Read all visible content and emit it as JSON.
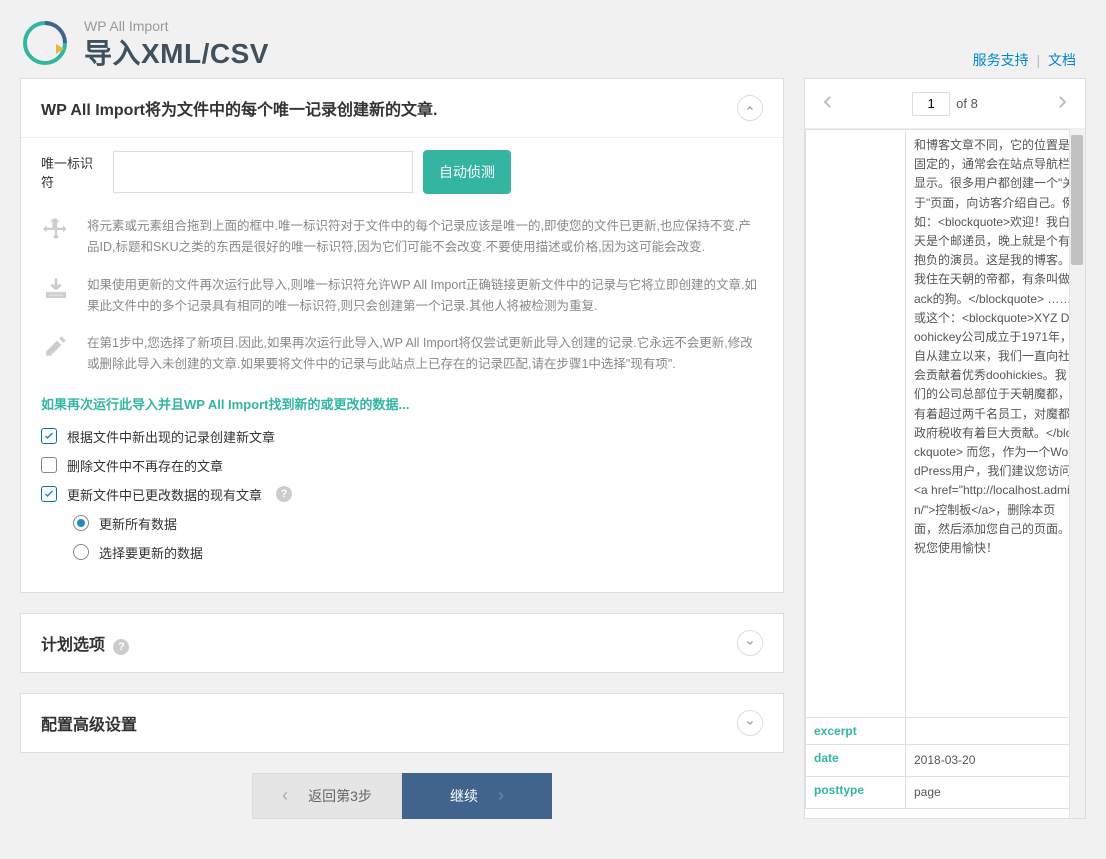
{
  "header": {
    "subtitle": "WP All Import",
    "title": "导入XML/CSV",
    "support_link": "服务支持",
    "docs_link": "文档"
  },
  "panel_records": {
    "title": "WP All Import将为文件中的每个唯一记录创建新的文章.",
    "unique_label": "唯一标识符",
    "unique_value": "",
    "autodetect": "自动侦测",
    "info1": "将元素或元素组合拖到上面的框中.唯一标识符对于文件中的每个记录应该是唯一的,即使您的文件已更新,也应保持不变.产品ID,标题和SKU之类的东西是很好的唯一标识符,因为它们可能不会改变.不要使用描述或价格,因为这可能会改变.",
    "info2": "如果使用更新的文件再次运行此导入,则唯一标识符允许WP All Import正确链接更新文件中的记录与它将立即创建的文章.如果此文件中的多个记录具有相同的唯一标识符,则只会创建第一个记录.其他人将被检测为重复.",
    "info3": "在第1步中,您选择了新项目.因此,如果再次运行此导入,WP All Import将仅尝试更新此导入创建的记录.它永远不会更新,修改或删除此导入未创建的文章.如果要将文件中的记录与此站点上已存在的记录匹配,请在步骤1中选择\"现有项\".",
    "intro": "如果再次运行此导入并且WP All Import找到新的或更改的数据...",
    "opt_create": "根据文件中新出现的记录创建新文章",
    "opt_delete": "删除文件中不再存在的文章",
    "opt_update": "更新文件中已更改数据的现有文章",
    "radio_all": "更新所有数据",
    "radio_choose": "选择要更新的数据"
  },
  "panel_schedule": {
    "title": "计划选项"
  },
  "panel_advanced": {
    "title": "配置高级设置"
  },
  "footer": {
    "back": "返回第3步",
    "continue": "继续"
  },
  "preview": {
    "page": "1",
    "of_label": "of 8",
    "content": "和博客文章不同，它的位置是固定的，通常会在站点导航栏显示。很多用户都创建一个\"关于\"页面，向访客介绍自己。例如：<blockquote>欢迎！我白天是个邮递员，晚上就是个有抱负的演员。这是我的博客。我住在天朝的帝都，有条叫做Jack的狗。</blockquote> ……或这个：<blockquote>XYZ Doohickey公司成立于1971年，自从建立以来，我们一直向社会贡献着优秀doohickies。我们的公司总部位于天朝魔都，有着超过两千名员工，对魔都政府税收有着巨大贡献。</blockquote> 而您，作为一个WordPress用户，我们建议您访问<a href=\"http://localhost.admin/\">控制板</a>，删除本页面，然后添加您自己的页面。祝您使用愉快！",
    "rows": [
      {
        "key": "excerpt",
        "val": ""
      },
      {
        "key": "date",
        "val": "2018-03-20"
      },
      {
        "key": "posttype",
        "val": "page"
      }
    ]
  }
}
